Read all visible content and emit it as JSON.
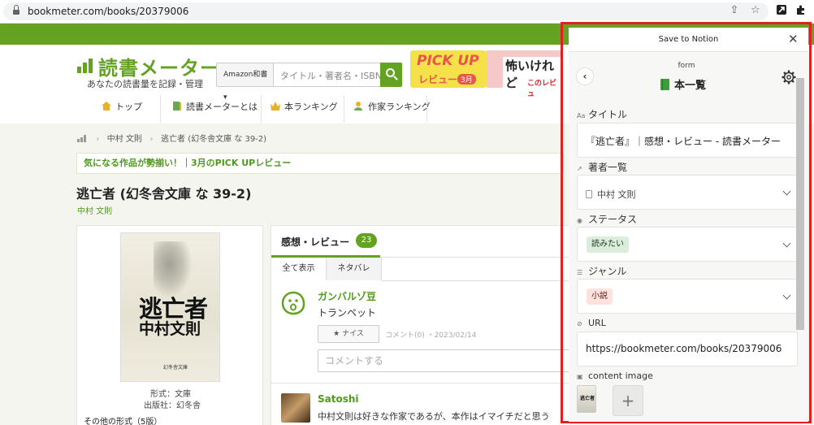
{
  "browser": {
    "url": "bookmeter.com/books/20379006"
  },
  "site": {
    "logo_text": "読書メーター",
    "tagline": "あなたの読書量を記録・管理",
    "search_select": "Amazon和書 ▾",
    "search_placeholder": "タイトル・著者名・ISBN",
    "banner1_title": "PICK UP",
    "banner1_sub": "レビュー",
    "banner1_badge": "3月",
    "banner2_title": "怖いけれど",
    "banner2_sub": "このレビュ",
    "nav": [
      "トップ",
      "読書メーターとは",
      "本ランキング",
      "作家ランキング"
    ],
    "breadcrumb": {
      "author": "中村 文則",
      "book": "逃亡者 (幻冬舎文庫 な 39-2)"
    },
    "pickup": "気になる作品が勢揃い！｜3月のPICK UPレビュー",
    "book_title": "逃亡者 (幻冬舎文庫 な 39-2)",
    "book_author": "中村 文則",
    "cover_title": "逃亡者",
    "cover_author": "中村文則",
    "cover_publisher": "幻冬舎文庫",
    "format": "形式：文庫",
    "publisher": "出版社：幻冬舎",
    "other_formats": "その他の形式（5版）"
  },
  "reviews": {
    "heading": "感想・レビュー",
    "count": "23",
    "tab_all": "全て表示",
    "tab_spoiler": "ネタバレ",
    "first": {
      "user": "ガンバルゾ豆",
      "text": "トランペット",
      "nice": "★ ナイス",
      "meta": "コメント(0) ・2023/02/14",
      "comment_placeholder": "コメントする"
    },
    "second": {
      "user": "Satoshi",
      "text": "中村文則は好きな作家であるが、本作はイマイチだと思う"
    }
  },
  "notion": {
    "title": "Save to Notion",
    "close": "✕",
    "back": "‹",
    "form_label": "form",
    "database": "本一覧",
    "fields": {
      "title_label": "タイトル",
      "title_value": "『逃亡者』｜感想・レビュー - 読書メーター",
      "authors_label": "著者一覧",
      "authors_value": "中村 文則",
      "status_label": "ステータス",
      "status_value": "読みたい",
      "genre_label": "ジャンル",
      "genre_value": "小説",
      "url_label": "URL",
      "url_value": "https://bookmeter.com/books/20379006",
      "image_label": "content image",
      "add": "+"
    }
  },
  "colors": {
    "brand_green": "#63a321",
    "frame_red": "#e12020",
    "status_tag": "#dbeddb",
    "genre_tag": "#ffe2dd"
  }
}
